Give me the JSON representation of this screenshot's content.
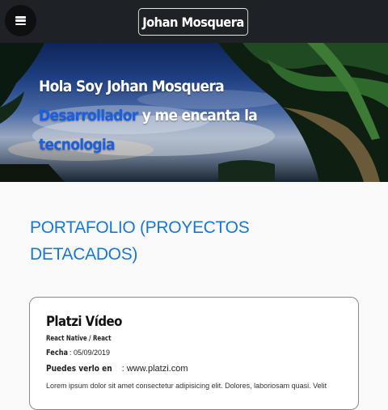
{
  "navbar": {
    "menu_icon": "hamburger-menu-icon",
    "brand": "Johan Mosquera"
  },
  "hero": {
    "line1": "Hola Soy Johan Mosquera",
    "highlight1": "Desarrollador",
    "line2_rest": " y me encanta la",
    "highlight2": "tecnologia",
    "highlight_color": "#1a5fe0"
  },
  "portfolio": {
    "title": "PORTAFOLIO (PROYECTOS DETACADOS)",
    "title_color": "#1976d2",
    "projects": [
      {
        "title": "Platzi Vídeo",
        "tech": "React Native / React",
        "date_label": "Fecha",
        "date_value": ": 05/09/2019",
        "url_label": "Puedes verlo en",
        "url_value": ": www.platzi.com",
        "description": "Lorem ipsum dolor sit amet consectetur adipisicing elit. Dolores, laboriosam quasi. Velit"
      }
    ]
  }
}
